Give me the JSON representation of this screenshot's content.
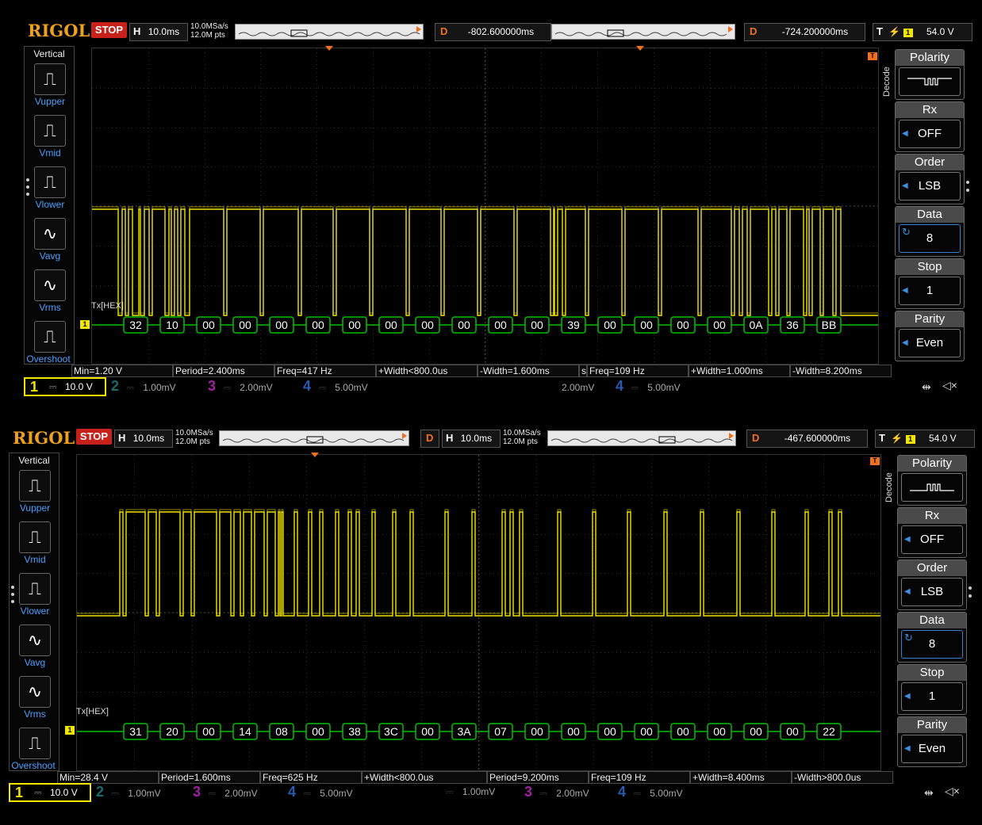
{
  "brand": "RIGOL",
  "colors": {
    "ch1": "#f2e600",
    "decode": "#00c000",
    "accent": "#f07020",
    "select": "#3a7fd0"
  },
  "vertical_title": "Vertical",
  "vertical_items": [
    "Vupper",
    "Vmid",
    "Vlower",
    "Vavg",
    "Vrms",
    "Overshoot"
  ],
  "decode_title": "Decode",
  "channels": {
    "ch2": {
      "n": "2",
      "scale": "1.00mV"
    },
    "ch3": {
      "n": "3",
      "scale": "2.00mV"
    },
    "ch4": {
      "n": "4",
      "scale": "5.00mV"
    }
  },
  "icons": [
    "usb-icon",
    "speaker-mute-icon"
  ],
  "screens": [
    {
      "status": "STOP",
      "timebase": {
        "label": "H",
        "value": "10.0ms"
      },
      "sample": {
        "rate": "10.0MSa/s",
        "points": "12.0M pts"
      },
      "zoom_timebase": null,
      "delay1": {
        "label": "D",
        "value": "-802.600000ms"
      },
      "delay2": {
        "label": "D",
        "value": "-724.200000ms"
      },
      "trigger": {
        "label": "T",
        "level": "54.0 V"
      },
      "polarity": {
        "title": "Polarity"
      },
      "rx": {
        "title": "Rx",
        "value": "OFF"
      },
      "order": {
        "title": "Order",
        "value": "LSB"
      },
      "data": {
        "title": "Data",
        "value": "8"
      },
      "stop": {
        "title": "Stop",
        "value": "1"
      },
      "parity": {
        "title": "Parity",
        "value": "Even"
      },
      "decode_label": "Tx[HEX]",
      "bytes": [
        "32",
        "10",
        "00",
        "00",
        "00",
        "00",
        "00",
        "00",
        "00",
        "00",
        "00",
        "00",
        "39",
        "00",
        "00",
        "00",
        "00",
        "0A",
        "36",
        "BB"
      ],
      "measurements": [
        "Min=1.20 V",
        "Period=2.400ms",
        "Freq=417 Hz",
        "+Width<800.0us",
        "-Width=1.600ms",
        "s",
        "Freq=109 Hz",
        "+Width=1.000ms",
        "-Width=8.200ms"
      ],
      "ch1": {
        "n": "1",
        "scale": "10.0 V"
      },
      "ghost": {
        "scale3": "2.00mV",
        "n4": "4",
        "scale4": "5.00mV"
      }
    },
    {
      "status": "STOP",
      "timebase": {
        "label": "H",
        "value": "10.0ms"
      },
      "sample": {
        "rate": "10.0MSa/s",
        "points": "12.0M pts"
      },
      "zoom_timebase": {
        "d": "D",
        "label": "H",
        "value": "10.0ms",
        "rate": "10.0MSa/s",
        "points": "12.0M pts"
      },
      "delay1": null,
      "delay2": {
        "label": "D",
        "value": "-467.600000ms"
      },
      "trigger": {
        "label": "T",
        "level": "54.0 V"
      },
      "polarity": {
        "title": "Polarity"
      },
      "rx": {
        "title": "Rx",
        "value": "OFF"
      },
      "order": {
        "title": "Order",
        "value": "LSB"
      },
      "data": {
        "title": "Data",
        "value": "8"
      },
      "stop": {
        "title": "Stop",
        "value": "1"
      },
      "parity": {
        "title": "Parity",
        "value": "Even"
      },
      "decode_label": "Tx[HEX]",
      "bytes": [
        "31",
        "20",
        "00",
        "14",
        "08",
        "00",
        "38",
        "3C",
        "00",
        "3A",
        "07",
        "00",
        "00",
        "00",
        "00",
        "00",
        "00",
        "00",
        "00",
        "22"
      ],
      "measurements": [
        "Min=28.4 V",
        "Period=1.600ms",
        "Freq=625 Hz",
        "+Width<800.0us",
        "Period=9.200ms",
        "Freq=109 Hz",
        "+Width=8.400ms",
        "-Width>800.0us"
      ],
      "ch1": {
        "n": "1",
        "scale": "10.0 V"
      },
      "ghost": {
        "scale2": "1.00mV",
        "n3": "3",
        "scale3": "2.00mV",
        "n4": "4",
        "scale4": "5.00mV"
      }
    }
  ]
}
